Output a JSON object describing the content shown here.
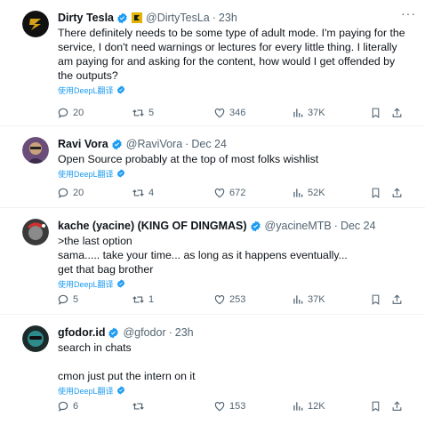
{
  "tweets": [
    {
      "name": "Dirty Tesla",
      "handle": "@DirtyTesLa",
      "time": "23h",
      "has_flag": true,
      "lines": [
        "There definitely needs to be some type of adult mode. I'm paying for the service, I don't need warnings or lectures for every little thing. I literally am paying for and asking for the content, how would I get offended by the outputs?"
      ],
      "translate": "使用DeepL翻译",
      "replies": "20",
      "retweets": "5",
      "likes": "346",
      "views": "37K",
      "avatar_color": "#111111"
    },
    {
      "name": "Ravi Vora",
      "handle": "@RaviVora",
      "time": "Dec 24",
      "lines": [
        "Open Source probably at the top of most folks wishlist"
      ],
      "translate": "使用DeepL翻译",
      "replies": "20",
      "retweets": "4",
      "likes": "672",
      "views": "52K",
      "avatar_color": "#6b4d7a"
    },
    {
      "name": "kache (yacine) (KING OF DINGMAS)",
      "handle": "@yacineMTB",
      "time": "Dec 24",
      "lines": [
        ">the last option",
        "sama..... take your time... as long as it happens eventually... get that bag brother"
      ],
      "translate": "使用DeepL翻译",
      "replies": "5",
      "retweets": "1",
      "likes": "253",
      "views": "37K",
      "avatar_color": "#3a3a3a"
    },
    {
      "name": "gfodor.id",
      "handle": "@gfodor",
      "time": "23h",
      "lines": [
        "search in chats",
        "cmon just put the intern on it"
      ],
      "translate": "使用DeepL翻译",
      "replies": "6",
      "retweets": "",
      "likes": "153",
      "views": "12K",
      "avatar_color": "#1c2a2a"
    }
  ],
  "icons": {
    "verified": "verified-badge-icon",
    "more": "more-options-icon",
    "reply": "reply-icon",
    "retweet": "retweet-icon",
    "like": "heart-icon",
    "views": "views-icon",
    "bookmark": "bookmark-icon",
    "share": "share-icon",
    "translate": "translate-badge-icon"
  },
  "colors": {
    "accent": "#1d9bf0",
    "text": "#0f1419",
    "muted": "#536471"
  }
}
